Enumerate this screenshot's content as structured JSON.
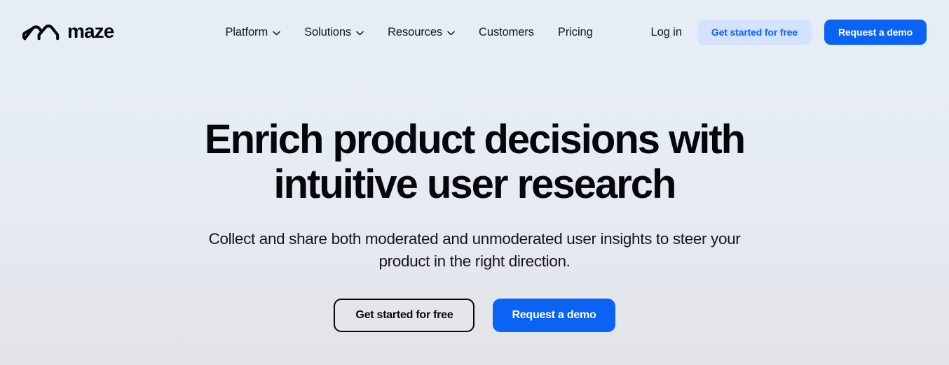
{
  "brand": {
    "name": "maze",
    "logo_icon": "maze-arches-logo-icon"
  },
  "nav": {
    "items": [
      {
        "label": "Platform",
        "has_dropdown": true,
        "icon": "chevron-down-icon"
      },
      {
        "label": "Solutions",
        "has_dropdown": true,
        "icon": "chevron-down-icon"
      },
      {
        "label": "Resources",
        "has_dropdown": true,
        "icon": "chevron-down-icon"
      },
      {
        "label": "Customers",
        "has_dropdown": false,
        "icon": ""
      },
      {
        "label": "Pricing",
        "has_dropdown": false,
        "icon": ""
      }
    ],
    "login_label": "Log in",
    "secondary_cta_label": "Get started for free",
    "primary_cta_label": "Request a demo"
  },
  "hero": {
    "title_line_1": "Enrich product decisions with",
    "title_line_2": "intuitive user research",
    "subtitle": "Collect and share both moderated and unmoderated user insights to steer your product in the right direction.",
    "cta_outline_label": "Get started for free",
    "cta_primary_label": "Request a demo"
  },
  "colors": {
    "brand_blue": "#0b63f6",
    "soft_blue_bg": "#d4e2fd",
    "ink": "#06070a",
    "bg_top": "#e7edf6",
    "bg_bottom": "#e2e4e9"
  }
}
